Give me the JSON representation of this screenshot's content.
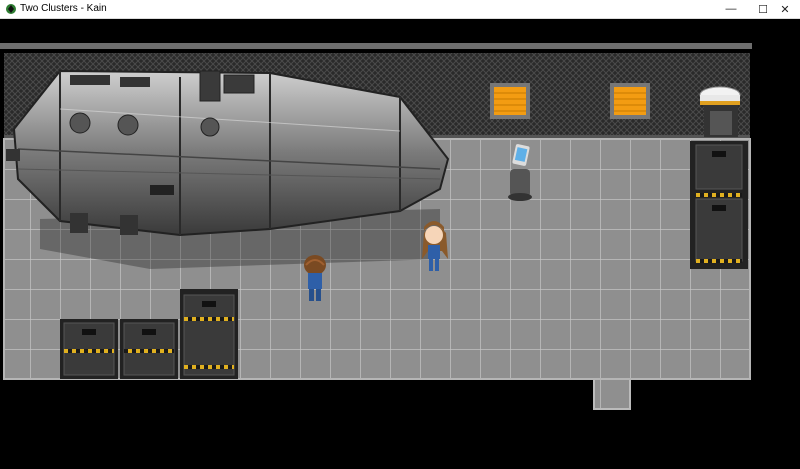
{
  "window": {
    "title": "Two Clusters - Kain",
    "controls": {
      "minimize": "—",
      "maximize": "☐",
      "close": "✕"
    }
  },
  "colors": {
    "floor_tile": "#8f8f8f",
    "floor_grid": "#c2c2c2",
    "wall_mesh": "#2a2a2a",
    "warning_panel": "#f39c12",
    "hazard_stripe": "#e0b020",
    "terminal_screen": "#5fb0e8"
  },
  "scene": {
    "location": "hangar",
    "objects": [
      "spaceship",
      "orange-wall-panel",
      "orange-wall-panel",
      "reactor-pillar",
      "computer-terminal",
      "cargo-lift",
      "cargo-lift",
      "cargo-lift",
      "cargo-lift",
      "cargo-lift"
    ],
    "characters": [
      {
        "name": "player",
        "facing": "up"
      },
      {
        "name": "npc-girl",
        "facing": "left"
      }
    ]
  }
}
